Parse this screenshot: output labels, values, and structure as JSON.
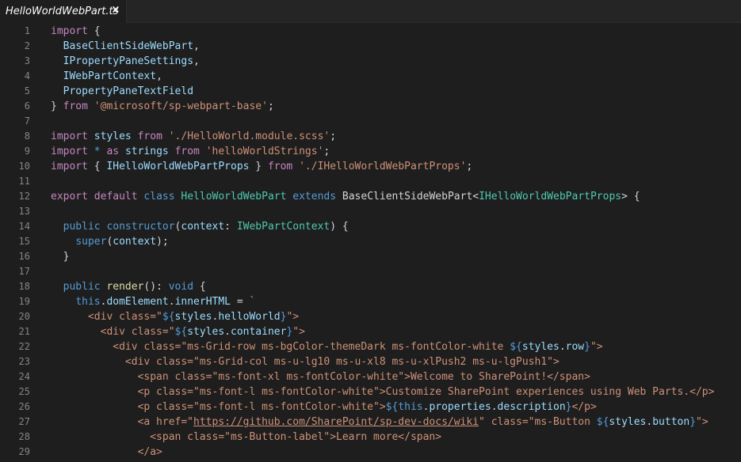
{
  "tab": {
    "title": "HelloWorldWebPart.ts",
    "close_glyph": "×"
  },
  "lines": [
    {
      "n": "1",
      "t": [
        [
          "kw",
          "import"
        ],
        [
          "plain",
          " {"
        ]
      ]
    },
    {
      "n": "2",
      "t": [
        [
          "plain",
          "  "
        ],
        [
          "id",
          "BaseClientSideWebPart"
        ],
        [
          "plain",
          ","
        ]
      ]
    },
    {
      "n": "3",
      "t": [
        [
          "plain",
          "  "
        ],
        [
          "id",
          "IPropertyPaneSettings"
        ],
        [
          "plain",
          ","
        ]
      ]
    },
    {
      "n": "4",
      "t": [
        [
          "plain",
          "  "
        ],
        [
          "id",
          "IWebPartContext"
        ],
        [
          "plain",
          ","
        ]
      ]
    },
    {
      "n": "5",
      "t": [
        [
          "plain",
          "  "
        ],
        [
          "id",
          "PropertyPaneTextField"
        ]
      ]
    },
    {
      "n": "6",
      "t": [
        [
          "plain",
          "} "
        ],
        [
          "kw",
          "from"
        ],
        [
          "plain",
          " "
        ],
        [
          "str",
          "'@microsoft/sp-webpart-base'"
        ],
        [
          "plain",
          ";"
        ]
      ]
    },
    {
      "n": "7",
      "t": []
    },
    {
      "n": "8",
      "t": [
        [
          "kw",
          "import"
        ],
        [
          "plain",
          " "
        ],
        [
          "id",
          "styles"
        ],
        [
          "plain",
          " "
        ],
        [
          "kw",
          "from"
        ],
        [
          "plain",
          " "
        ],
        [
          "str",
          "'./HelloWorld.module.scss'"
        ],
        [
          "plain",
          ";"
        ]
      ]
    },
    {
      "n": "9",
      "t": [
        [
          "kw",
          "import"
        ],
        [
          "plain",
          " "
        ],
        [
          "kw2",
          "*"
        ],
        [
          "plain",
          " "
        ],
        [
          "kw",
          "as"
        ],
        [
          "plain",
          " "
        ],
        [
          "id",
          "strings"
        ],
        [
          "plain",
          " "
        ],
        [
          "kw",
          "from"
        ],
        [
          "plain",
          " "
        ],
        [
          "str",
          "'helloWorldStrings'"
        ],
        [
          "plain",
          ";"
        ]
      ]
    },
    {
      "n": "10",
      "t": [
        [
          "kw",
          "import"
        ],
        [
          "plain",
          " { "
        ],
        [
          "id",
          "IHelloWorldWebPartProps"
        ],
        [
          "plain",
          " } "
        ],
        [
          "kw",
          "from"
        ],
        [
          "plain",
          " "
        ],
        [
          "str",
          "'./IHelloWorldWebPartProps'"
        ],
        [
          "plain",
          ";"
        ]
      ]
    },
    {
      "n": "11",
      "t": []
    },
    {
      "n": "12",
      "t": [
        [
          "kw",
          "export"
        ],
        [
          "plain",
          " "
        ],
        [
          "kw",
          "default"
        ],
        [
          "plain",
          " "
        ],
        [
          "kw2",
          "class"
        ],
        [
          "plain",
          " "
        ],
        [
          "type",
          "HelloWorldWebPart"
        ],
        [
          "plain",
          " "
        ],
        [
          "kw2",
          "extends"
        ],
        [
          "plain",
          " "
        ],
        [
          "plain",
          "BaseClientSideWebPart<"
        ],
        [
          "type",
          "IHelloWorldWebPartProps"
        ],
        [
          "plain",
          "> {"
        ]
      ]
    },
    {
      "n": "13",
      "t": []
    },
    {
      "n": "14",
      "t": [
        [
          "plain",
          "  "
        ],
        [
          "kw2",
          "public"
        ],
        [
          "plain",
          " "
        ],
        [
          "kw2",
          "constructor"
        ],
        [
          "plain",
          "("
        ],
        [
          "id",
          "context"
        ],
        [
          "plain",
          ": "
        ],
        [
          "type",
          "IWebPartContext"
        ],
        [
          "plain",
          ") {"
        ]
      ]
    },
    {
      "n": "15",
      "t": [
        [
          "plain",
          "    "
        ],
        [
          "kw2",
          "super"
        ],
        [
          "plain",
          "("
        ],
        [
          "id",
          "context"
        ],
        [
          "plain",
          ");"
        ]
      ]
    },
    {
      "n": "16",
      "t": [
        [
          "plain",
          "  }"
        ]
      ]
    },
    {
      "n": "17",
      "t": []
    },
    {
      "n": "18",
      "t": [
        [
          "plain",
          "  "
        ],
        [
          "kw2",
          "public"
        ],
        [
          "plain",
          " "
        ],
        [
          "fn",
          "render"
        ],
        [
          "plain",
          "(): "
        ],
        [
          "kw2",
          "void"
        ],
        [
          "plain",
          " {"
        ]
      ]
    },
    {
      "n": "19",
      "t": [
        [
          "plain",
          "    "
        ],
        [
          "kw2",
          "this"
        ],
        [
          "plain",
          "."
        ],
        [
          "id",
          "domElement"
        ],
        [
          "plain",
          "."
        ],
        [
          "id",
          "innerHTML"
        ],
        [
          "plain",
          " = "
        ],
        [
          "str",
          "`"
        ]
      ]
    },
    {
      "n": "20",
      "t": [
        [
          "str",
          "      <div class=\""
        ],
        [
          "kw2",
          "${"
        ],
        [
          "id",
          "styles"
        ],
        [
          "plain",
          "."
        ],
        [
          "id",
          "helloWorld"
        ],
        [
          "kw2",
          "}"
        ],
        [
          "str",
          "\">"
        ]
      ]
    },
    {
      "n": "21",
      "t": [
        [
          "str",
          "        <div class=\""
        ],
        [
          "kw2",
          "${"
        ],
        [
          "id",
          "styles"
        ],
        [
          "plain",
          "."
        ],
        [
          "id",
          "container"
        ],
        [
          "kw2",
          "}"
        ],
        [
          "str",
          "\">"
        ]
      ]
    },
    {
      "n": "22",
      "t": [
        [
          "str",
          "          <div class=\"ms-Grid-row ms-bgColor-themeDark ms-fontColor-white "
        ],
        [
          "kw2",
          "${"
        ],
        [
          "id",
          "styles"
        ],
        [
          "plain",
          "."
        ],
        [
          "id",
          "row"
        ],
        [
          "kw2",
          "}"
        ],
        [
          "str",
          "\">"
        ]
      ]
    },
    {
      "n": "23",
      "t": [
        [
          "str",
          "            <div class=\"ms-Grid-col ms-u-lg10 ms-u-xl8 ms-u-xlPush2 ms-u-lgPush1\">"
        ]
      ]
    },
    {
      "n": "24",
      "t": [
        [
          "str",
          "              <span class=\"ms-font-xl ms-fontColor-white\">Welcome to SharePoint!</span>"
        ]
      ]
    },
    {
      "n": "25",
      "t": [
        [
          "str",
          "              <p class=\"ms-font-l ms-fontColor-white\">Customize SharePoint experiences using Web Parts.</p>"
        ]
      ]
    },
    {
      "n": "26",
      "t": [
        [
          "str",
          "              <p class=\"ms-font-l ms-fontColor-white\">"
        ],
        [
          "kw2",
          "${"
        ],
        [
          "kw2",
          "this"
        ],
        [
          "plain",
          "."
        ],
        [
          "id",
          "properties"
        ],
        [
          "plain",
          "."
        ],
        [
          "id",
          "description"
        ],
        [
          "kw2",
          "}"
        ],
        [
          "str",
          "</p>"
        ]
      ]
    },
    {
      "n": "27",
      "t": [
        [
          "str",
          "              <a href=\""
        ],
        [
          "link",
          "https://github.com/SharePoint/sp-dev-docs/wiki"
        ],
        [
          "str",
          "\" class=\"ms-Button "
        ],
        [
          "kw2",
          "${"
        ],
        [
          "id",
          "styles"
        ],
        [
          "plain",
          "."
        ],
        [
          "id",
          "button"
        ],
        [
          "kw2",
          "}"
        ],
        [
          "str",
          "\">"
        ]
      ]
    },
    {
      "n": "28",
      "t": [
        [
          "str",
          "                <span class=\"ms-Button-label\">Learn more</span>"
        ]
      ]
    },
    {
      "n": "29",
      "t": [
        [
          "str",
          "              </a>"
        ]
      ]
    }
  ]
}
